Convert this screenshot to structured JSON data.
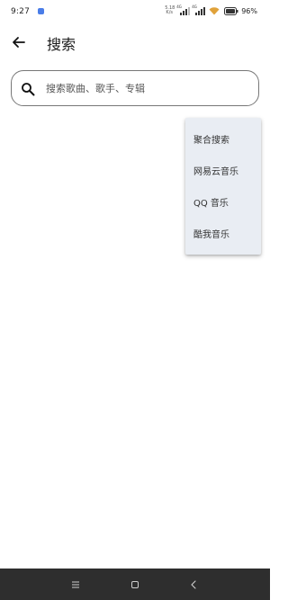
{
  "status_bar": {
    "time": "9:27",
    "net_speed_value": "5.18",
    "net_speed_unit": "K/s",
    "signal_1_label": "4G",
    "signal_2_label": "4G",
    "battery_percent": "96%"
  },
  "header": {
    "title": "搜索"
  },
  "search": {
    "placeholder": "搜索歌曲、歌手、专辑"
  },
  "dropdown": {
    "items": [
      {
        "label": "聚合搜索"
      },
      {
        "label": "网易云音乐"
      },
      {
        "label": "QQ 音乐"
      },
      {
        "label": "酷我音乐"
      }
    ]
  },
  "colors": {
    "menu_background": "#e9edf3",
    "nav_bar": "#2e2e2e",
    "search_border": "#777777"
  },
  "icons": {
    "back": "arrow-left-icon",
    "search": "search-icon",
    "nav_menu": "menu-lines-icon",
    "nav_home": "square-home-icon",
    "nav_back": "chevron-left-icon"
  }
}
